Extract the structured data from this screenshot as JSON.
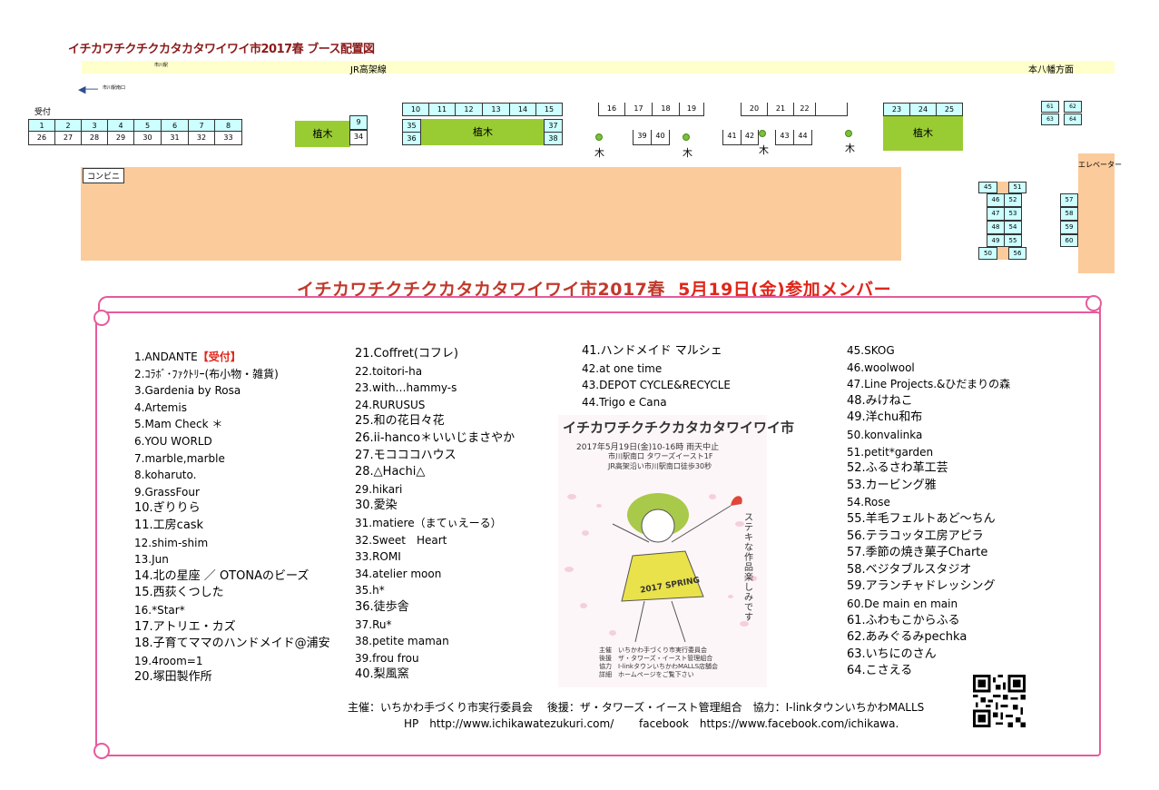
{
  "map": {
    "title": "イチカワチクチクカタカタワイワイ市2017春 ブース配置図",
    "jr_line": "JR高架線",
    "ichikawa_station": "市川駅",
    "motoyawata": "本八幡方面",
    "south_exit": "市川駅南口",
    "reception": "受付",
    "plant_label": "植木",
    "tree_label": "木",
    "konbini": "コンビニ",
    "elevator": "エレベーター",
    "row1_top": [
      "1",
      "2",
      "3",
      "4",
      "5",
      "6",
      "7",
      "8"
    ],
    "row1_bottom": [
      "26",
      "27",
      "28",
      "29",
      "30",
      "31",
      "32",
      "33"
    ],
    "b9": "9",
    "b34": "34",
    "row2_top": [
      "10",
      "11",
      "12",
      "13",
      "14",
      "15"
    ],
    "b35": "35",
    "b36": "36",
    "b37": "37",
    "b38": "38",
    "row3_top": [
      "16",
      "17",
      "18",
      "19"
    ],
    "b39": "39",
    "b40": "40",
    "row4_top": [
      "20",
      "21",
      "22"
    ],
    "b41": "41",
    "b42": "42",
    "b43": "43",
    "b44": "44",
    "row5_top": [
      "23",
      "24",
      "25"
    ],
    "b61": "61",
    "b62": "62",
    "b63": "63",
    "b64": "64",
    "b45": "45",
    "b51": "51",
    "left_col": [
      "46",
      "47",
      "48",
      "49"
    ],
    "right_col": [
      "52",
      "53",
      "54",
      "55"
    ],
    "b50": "50",
    "b56": "56",
    "far_col": [
      "57",
      "58",
      "59",
      "60"
    ]
  },
  "members_title_a": "イチカワチクチクカタカタワイワイ市2017春",
  "members_title_b": "5月19日(金)参加メンバー",
  "members": {
    "col1": [
      "1.ANDANTE",
      "2.ｺﾗﾎﾞ･ﾌｧｸﾄﾘｰ(布小物・雑貨)",
      "3.Gardenia by Rosa",
      "4.Artemis",
      "5.Mam Check ＊",
      "6.YOU WORLD",
      "7.marble,marble",
      "8.koharuto.",
      "9.GrassFour",
      "10.ぎりりら",
      "11.工房cask",
      "12.shim-shim",
      "13.Jun",
      "14.北の星座 ／ OTONAのビーズ",
      "15.西荻くつした",
      "16.*Star*",
      "17.アトリエ・カズ",
      "18.子育てママのハンドメイド@浦安",
      "19.4room=1",
      "20.塚田製作所"
    ],
    "reception_tag": "【受付】",
    "col2": [
      "21.Coffret(コフレ)",
      "22.toitori-ha",
      "23.with…hammy-s",
      "24.RURUSUS",
      "25.和の花日々花",
      "26.ii-hanco＊いいじまさやか",
      "27.モコココハウス",
      "28.△Hachi△",
      "29.hikari",
      "30.愛染",
      "31.matiere（まてぃえーる）",
      "32.Sweet　Heart",
      "33.ROMI",
      "34.atelier moon",
      "35.h*",
      "36.徒歩舎",
      "37.Ru*",
      "38.petite maman",
      "39.frou frou",
      "40.梨風窯"
    ],
    "col3": [
      "41.ハンドメイド マルシェ",
      "42.at one time",
      "43.DEPOT CYCLE&RECYCLE",
      "44.Trigo e Cana"
    ],
    "col4": [
      "45.SKOG",
      "46.woolwool",
      "47.Line Projects.&ひだまりの森",
      "48.みけねこ",
      "49.洋chu和布",
      "50.konvalinka",
      "51.petit*garden",
      "52.ふるさわ革工芸",
      "53.カービング雅",
      "54.Rose",
      "55.羊毛フェルトあど～ちん",
      "56.テラコッタ工房アピラ",
      "57.季節の焼き菓子Charte",
      "58.ベジタブルスタジオ",
      "59.アランチャドレッシング",
      "60.De main en main",
      "61.ふわもこからふる",
      "62.あみぐるみpechka",
      "63.いちにのさん",
      "64.こさえる"
    ]
  },
  "poster": {
    "title": "イチカワチクチクカタカタワイワイ市",
    "date": "2017年5月19日(金)10-16時 雨天中止",
    "venue1": "市川駅南口 タワーズイースト1F",
    "venue2": "JR高架沿い市川駅南口徒歩30秒",
    "side_text": "ステキな作品楽しみです",
    "badge": "2017 SPRING",
    "credits": [
      "主催　いちかわ手づくり市実行委員会",
      "後援　ザ・タワーズ・イースト管理組合",
      "協力　I-linkタウンいちかわMALLS店舗会",
      "詳細　ホームページをご覧下さい"
    ]
  },
  "footer": {
    "line1": "主催：いちかわ手づくり市実行委員会　 後援：ザ・タワーズ・イースト管理組合　協力：I-linkタウンいちかわMALLS",
    "line2": "HP　http://www.ichikawatezukuri.com/　　 facebook　https://www.facebook.com/ichikawa."
  }
}
